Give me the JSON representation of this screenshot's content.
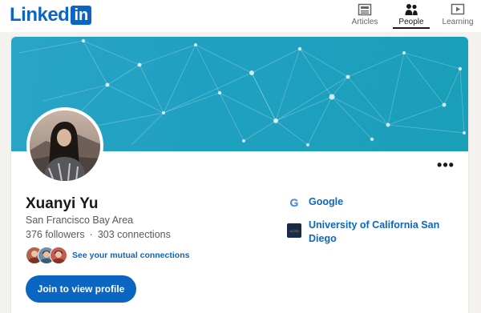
{
  "brand": {
    "logo_text": "Linked",
    "logo_box_text": "in",
    "color": "#0a66c2"
  },
  "nav": {
    "items": [
      {
        "label": "Articles",
        "icon": "articles-icon",
        "active": false
      },
      {
        "label": "People",
        "icon": "people-icon",
        "active": true
      },
      {
        "label": "Learning",
        "icon": "learning-icon",
        "active": false
      }
    ]
  },
  "profile": {
    "name": "Xuanyi Yu",
    "location": "San Francisco Bay Area",
    "followers": "376 followers",
    "separator": "·",
    "connections": "303 connections",
    "mutual_link": "See your mutual connections",
    "join_button": "Join to view profile",
    "more_icon": "more-icon",
    "banner_color": "#1fa0c0"
  },
  "experience": [
    {
      "name": "Google",
      "icon": "google-logo-icon"
    },
    {
      "name": "University of California San Diego",
      "icon": "ucsd-logo-icon"
    }
  ]
}
